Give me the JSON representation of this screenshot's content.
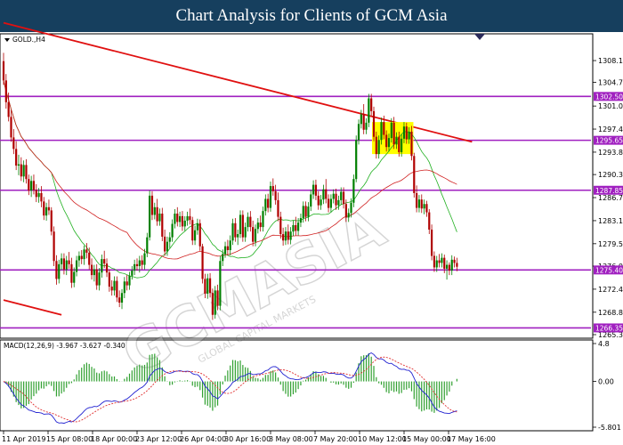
{
  "banner": {
    "title": "Chart Analysis for Clients of GCM Asia"
  },
  "watermark": {
    "text": "GCMASIA",
    "sub": "GLOBAL CAPITAL MARKETS"
  },
  "colors": {
    "bull": "#008000",
    "bear": "#b00000",
    "level": "#a020c0",
    "trend": "#e01010",
    "ma_green": "#20b020",
    "ma_red": "#d02020",
    "macd_line": "#2020d0",
    "signal": "#e03030",
    "hist": "#30a030",
    "highlight": "#ffff00",
    "banner_bg": "#163f5e"
  },
  "chart_data": [
    {
      "type": "candlestick",
      "symbol": "GOLD.,H4",
      "ylim": [
        1265.3,
        1312.0
      ],
      "price_ticks": [
        "1308.10",
        "1304.70",
        "1301.00",
        "1297.40",
        "1293.80",
        "1290.30",
        "1286.70",
        "1283.10",
        "1279.50",
        "1276.00",
        "1272.40",
        "1268.80",
        "1265.30"
      ],
      "x_labels": [
        "11 Apr 2019",
        "15 Apr 08:00",
        "18 Apr 00:00",
        "23 Apr 12:00",
        "26 Apr 04:00",
        "30 Apr 16:00",
        "3 May 08:00",
        "7 May 20:00",
        "10 May 12:00",
        "15 May 00:00",
        "17 May 16:00"
      ],
      "levels": [
        {
          "value": 1302.5,
          "label": "1302.50"
        },
        {
          "value": 1295.65,
          "label": "1295.65"
        },
        {
          "value": 1287.85,
          "label": "1287.85"
        },
        {
          "value": 1275.4,
          "label": "1275.40"
        },
        {
          "value": 1266.35,
          "label": "1266.35"
        }
      ],
      "trendlines": [
        {
          "from": [
            0,
            1314.0
          ],
          "to": [
            186,
            1295.4
          ]
        },
        {
          "from": [
            0,
            1270.7
          ],
          "to": [
            23,
            1268.4
          ]
        }
      ],
      "highlight_zone": {
        "from_bar": 147,
        "to_bar": 162,
        "ylim": [
          1293.5,
          1298.5
        ]
      },
      "candles": [
        [
          1308.0,
          1309.3,
          1304.3,
          1305.0
        ],
        [
          1305.0,
          1306.0,
          1300.6,
          1301.6
        ],
        [
          1301.6,
          1303.1,
          1298.6,
          1299.3
        ],
        [
          1299.3,
          1300.4,
          1295.4,
          1296.1
        ],
        [
          1296.1,
          1297.4,
          1293.5,
          1294.3
        ],
        [
          1294.3,
          1295.5,
          1291.0,
          1291.7
        ],
        [
          1291.7,
          1293.4,
          1290.2,
          1291.9
        ],
        [
          1291.9,
          1293.0,
          1289.3,
          1290.0
        ],
        [
          1290.0,
          1292.5,
          1289.1,
          1291.8
        ],
        [
          1291.8,
          1292.7,
          1288.9,
          1289.6
        ],
        [
          1289.6,
          1290.3,
          1287.1,
          1287.8
        ],
        [
          1287.8,
          1290.1,
          1286.8,
          1289.3
        ],
        [
          1289.3,
          1290.3,
          1287.2,
          1287.9
        ],
        [
          1287.9,
          1288.8,
          1286.0,
          1286.8
        ],
        [
          1286.8,
          1288.2,
          1285.9,
          1287.4
        ],
        [
          1287.4,
          1288.5,
          1285.2,
          1286.1
        ],
        [
          1286.1,
          1286.8,
          1283.2,
          1283.9
        ],
        [
          1283.9,
          1285.9,
          1283.1,
          1285.2
        ],
        [
          1285.2,
          1286.4,
          1284.0,
          1284.7
        ],
        [
          1284.7,
          1285.2,
          1280.8,
          1281.4
        ],
        [
          1281.4,
          1282.2,
          1276.0,
          1276.8
        ],
        [
          1276.8,
          1277.7,
          1273.1,
          1274.0
        ],
        [
          1274.0,
          1277.0,
          1273.3,
          1276.3
        ],
        [
          1276.3,
          1278.0,
          1275.4,
          1277.2
        ],
        [
          1277.2,
          1278.0,
          1274.7,
          1275.5
        ],
        [
          1275.5,
          1277.6,
          1274.6,
          1276.9
        ],
        [
          1276.9,
          1278.2,
          1275.6,
          1276.3
        ],
        [
          1276.3,
          1277.3,
          1272.6,
          1273.4
        ],
        [
          1273.4,
          1275.8,
          1272.7,
          1275.1
        ],
        [
          1275.1,
          1277.6,
          1274.4,
          1276.9
        ],
        [
          1276.9,
          1278.3,
          1275.9,
          1277.6
        ],
        [
          1277.6,
          1278.5,
          1276.3,
          1277.1
        ],
        [
          1277.1,
          1279.2,
          1276.2,
          1278.6
        ],
        [
          1278.6,
          1279.6,
          1277.2,
          1278.1
        ],
        [
          1278.1,
          1278.9,
          1275.5,
          1276.2
        ],
        [
          1276.2,
          1277.2,
          1273.9,
          1274.6
        ],
        [
          1274.6,
          1276.2,
          1273.6,
          1275.5
        ],
        [
          1275.5,
          1276.3,
          1272.3,
          1273.0
        ],
        [
          1273.0,
          1275.7,
          1272.2,
          1275.0
        ],
        [
          1275.0,
          1277.8,
          1274.2,
          1277.1
        ],
        [
          1277.1,
          1278.4,
          1275.7,
          1276.4
        ],
        [
          1276.4,
          1277.2,
          1274.3,
          1275.0
        ],
        [
          1275.0,
          1275.5,
          1272.0,
          1272.8
        ],
        [
          1272.8,
          1273.8,
          1271.4,
          1272.2
        ],
        [
          1272.2,
          1274.4,
          1271.4,
          1273.7
        ],
        [
          1273.7,
          1274.4,
          1270.4,
          1271.1
        ],
        [
          1271.1,
          1272.2,
          1269.6,
          1270.3
        ],
        [
          1270.3,
          1272.4,
          1269.3,
          1271.8
        ],
        [
          1271.8,
          1274.3,
          1271.0,
          1273.6
        ],
        [
          1273.6,
          1274.6,
          1272.2,
          1273.0
        ],
        [
          1273.0,
          1275.1,
          1272.3,
          1274.5
        ],
        [
          1274.5,
          1276.0,
          1273.9,
          1275.3
        ],
        [
          1275.3,
          1277.0,
          1274.6,
          1276.3
        ],
        [
          1276.3,
          1277.2,
          1275.3,
          1276.0
        ],
        [
          1276.0,
          1277.6,
          1275.0,
          1276.9
        ],
        [
          1276.9,
          1277.7,
          1275.5,
          1276.2
        ],
        [
          1276.2,
          1278.7,
          1275.5,
          1278.0
        ],
        [
          1278.0,
          1281.2,
          1277.4,
          1280.5
        ],
        [
          1280.5,
          1287.8,
          1280.0,
          1287.0
        ],
        [
          1287.0,
          1287.7,
          1283.2,
          1284.0
        ],
        [
          1284.0,
          1285.9,
          1283.3,
          1285.2
        ],
        [
          1285.2,
          1286.5,
          1282.3,
          1283.0
        ],
        [
          1283.0,
          1285.0,
          1282.3,
          1284.2
        ],
        [
          1284.2,
          1285.1,
          1279.9,
          1280.6
        ],
        [
          1280.6,
          1281.7,
          1277.6,
          1278.3
        ],
        [
          1278.3,
          1280.6,
          1277.6,
          1279.8
        ],
        [
          1279.8,
          1281.3,
          1278.8,
          1280.5
        ],
        [
          1280.5,
          1283.3,
          1279.8,
          1282.6
        ],
        [
          1282.6,
          1284.9,
          1281.9,
          1284.2
        ],
        [
          1284.2,
          1285.2,
          1282.2,
          1282.9
        ],
        [
          1282.9,
          1284.5,
          1282.1,
          1283.8
        ],
        [
          1283.8,
          1284.6,
          1281.5,
          1282.2
        ],
        [
          1282.2,
          1283.8,
          1281.5,
          1283.1
        ],
        [
          1283.1,
          1284.5,
          1282.3,
          1283.8
        ],
        [
          1283.8,
          1285.0,
          1282.5,
          1283.2
        ],
        [
          1283.2,
          1283.7,
          1279.3,
          1280.0
        ],
        [
          1280.0,
          1282.3,
          1279.3,
          1281.6
        ],
        [
          1281.6,
          1283.4,
          1280.9,
          1282.7
        ],
        [
          1282.7,
          1283.3,
          1278.4,
          1279.1
        ],
        [
          1279.1,
          1279.5,
          1273.3,
          1274.0
        ],
        [
          1274.0,
          1274.8,
          1271.0,
          1271.7
        ],
        [
          1271.7,
          1274.8,
          1270.9,
          1274.1
        ],
        [
          1274.1,
          1274.9,
          1271.1,
          1271.8
        ],
        [
          1271.8,
          1272.5,
          1267.6,
          1268.4
        ],
        [
          1268.4,
          1272.9,
          1267.8,
          1272.2
        ],
        [
          1272.2,
          1273.1,
          1269.1,
          1269.8
        ],
        [
          1269.8,
          1277.6,
          1269.1,
          1276.8
        ],
        [
          1276.8,
          1278.6,
          1276.0,
          1277.9
        ],
        [
          1277.9,
          1279.8,
          1277.3,
          1279.1
        ],
        [
          1279.1,
          1280.1,
          1277.7,
          1278.5
        ],
        [
          1278.5,
          1280.8,
          1277.7,
          1280.0
        ],
        [
          1280.0,
          1283.4,
          1279.3,
          1282.7
        ],
        [
          1282.7,
          1283.5,
          1279.8,
          1280.5
        ],
        [
          1280.5,
          1281.7,
          1279.3,
          1281.0
        ],
        [
          1281.0,
          1284.7,
          1280.4,
          1284.0
        ],
        [
          1284.0,
          1284.7,
          1279.8,
          1280.5
        ],
        [
          1280.5,
          1282.8,
          1279.8,
          1282.1
        ],
        [
          1282.1,
          1284.4,
          1281.4,
          1283.7
        ],
        [
          1283.7,
          1284.6,
          1281.4,
          1282.1
        ],
        [
          1282.1,
          1283.1,
          1279.1,
          1279.8
        ],
        [
          1279.8,
          1282.5,
          1279.1,
          1281.8
        ],
        [
          1281.8,
          1283.5,
          1281.1,
          1282.8
        ],
        [
          1282.8,
          1283.9,
          1281.4,
          1282.1
        ],
        [
          1282.1,
          1285.3,
          1281.4,
          1284.6
        ],
        [
          1284.6,
          1287.2,
          1283.9,
          1286.5
        ],
        [
          1286.5,
          1287.3,
          1284.4,
          1285.1
        ],
        [
          1285.1,
          1289.2,
          1284.5,
          1288.5
        ],
        [
          1288.5,
          1289.7,
          1287.0,
          1287.7
        ],
        [
          1287.7,
          1288.7,
          1285.6,
          1286.3
        ],
        [
          1286.3,
          1287.5,
          1283.0,
          1283.7
        ],
        [
          1283.7,
          1284.5,
          1280.3,
          1281.0
        ],
        [
          1281.0,
          1282.0,
          1279.2,
          1280.0
        ],
        [
          1280.0,
          1282.1,
          1279.3,
          1281.4
        ],
        [
          1281.4,
          1282.5,
          1279.4,
          1280.1
        ],
        [
          1280.1,
          1282.1,
          1279.4,
          1281.4
        ],
        [
          1281.4,
          1283.1,
          1280.7,
          1282.4
        ],
        [
          1282.4,
          1283.7,
          1280.8,
          1281.5
        ],
        [
          1281.5,
          1283.5,
          1280.8,
          1282.8
        ],
        [
          1282.8,
          1284.2,
          1282.1,
          1283.5
        ],
        [
          1283.5,
          1286.1,
          1282.8,
          1285.4
        ],
        [
          1285.4,
          1286.1,
          1283.0,
          1283.7
        ],
        [
          1283.7,
          1286.0,
          1283.0,
          1285.3
        ],
        [
          1285.3,
          1287.9,
          1284.6,
          1287.2
        ],
        [
          1287.2,
          1289.4,
          1286.5,
          1288.7
        ],
        [
          1288.7,
          1289.5,
          1286.3,
          1287.0
        ],
        [
          1287.0,
          1287.7,
          1284.8,
          1285.5
        ],
        [
          1285.5,
          1287.1,
          1284.8,
          1286.4
        ],
        [
          1286.4,
          1288.7,
          1285.7,
          1288.0
        ],
        [
          1288.0,
          1289.6,
          1285.8,
          1286.5
        ],
        [
          1286.5,
          1287.2,
          1284.4,
          1285.1
        ],
        [
          1285.1,
          1287.2,
          1284.4,
          1286.5
        ],
        [
          1286.5,
          1288.0,
          1285.8,
          1287.3
        ],
        [
          1287.3,
          1288.1,
          1284.8,
          1285.5
        ],
        [
          1285.5,
          1287.0,
          1284.8,
          1286.3
        ],
        [
          1286.3,
          1288.3,
          1285.6,
          1287.6
        ],
        [
          1287.6,
          1288.3,
          1285.0,
          1285.7
        ],
        [
          1285.7,
          1286.4,
          1282.9,
          1283.6
        ],
        [
          1283.6,
          1285.0,
          1282.9,
          1284.3
        ],
        [
          1284.3,
          1286.6,
          1283.6,
          1285.9
        ],
        [
          1285.9,
          1290.3,
          1285.2,
          1289.6
        ],
        [
          1289.6,
          1296.4,
          1289.1,
          1295.7
        ],
        [
          1295.7,
          1298.9,
          1295.0,
          1298.2
        ],
        [
          1298.2,
          1300.4,
          1297.5,
          1299.7
        ],
        [
          1299.7,
          1301.3,
          1296.6,
          1297.3
        ],
        [
          1297.3,
          1299.1,
          1296.6,
          1298.4
        ],
        [
          1298.4,
          1302.9,
          1297.7,
          1302.2
        ],
        [
          1302.2,
          1302.9,
          1299.5,
          1300.2
        ],
        [
          1300.2,
          1300.9,
          1295.5,
          1296.2
        ],
        [
          1296.2,
          1297.0,
          1292.8,
          1293.5
        ],
        [
          1293.5,
          1296.4,
          1292.8,
          1295.7
        ],
        [
          1295.7,
          1299.2,
          1295.0,
          1298.5
        ],
        [
          1298.5,
          1299.5,
          1295.8,
          1296.5
        ],
        [
          1296.5,
          1297.2,
          1293.9,
          1294.6
        ],
        [
          1294.6,
          1296.7,
          1293.9,
          1296.0
        ],
        [
          1296.0,
          1299.1,
          1295.3,
          1298.4
        ],
        [
          1298.4,
          1299.3,
          1294.3,
          1295.0
        ],
        [
          1295.0,
          1296.9,
          1294.3,
          1296.2
        ],
        [
          1296.2,
          1297.0,
          1293.1,
          1293.8
        ],
        [
          1293.8,
          1296.6,
          1293.1,
          1295.9
        ],
        [
          1295.9,
          1298.5,
          1295.2,
          1297.8
        ],
        [
          1297.8,
          1298.4,
          1295.1,
          1295.8
        ],
        [
          1295.8,
          1297.7,
          1295.1,
          1297.0
        ],
        [
          1297.0,
          1297.9,
          1292.5,
          1293.2
        ],
        [
          1293.2,
          1293.7,
          1286.7,
          1287.4
        ],
        [
          1287.4,
          1288.6,
          1284.4,
          1285.1
        ],
        [
          1285.1,
          1287.1,
          1284.4,
          1286.4
        ],
        [
          1286.4,
          1287.2,
          1284.3,
          1285.0
        ],
        [
          1285.0,
          1286.4,
          1284.1,
          1285.7
        ],
        [
          1285.7,
          1286.2,
          1283.7,
          1284.4
        ],
        [
          1284.4,
          1284.9,
          1281.0,
          1281.7
        ],
        [
          1281.7,
          1282.5,
          1276.9,
          1277.6
        ],
        [
          1277.6,
          1278.3,
          1275.1,
          1275.8
        ],
        [
          1275.8,
          1277.6,
          1275.1,
          1276.9
        ],
        [
          1276.9,
          1277.9,
          1275.8,
          1276.5
        ],
        [
          1276.5,
          1278.0,
          1275.8,
          1277.3
        ],
        [
          1277.3,
          1277.8,
          1274.9,
          1275.6
        ],
        [
          1275.6,
          1276.9,
          1273.9,
          1276.2
        ],
        [
          1276.2,
          1276.6,
          1274.6,
          1275.3
        ],
        [
          1275.3,
          1277.7,
          1274.6,
          1277.0
        ],
        [
          1277.0,
          1277.5,
          1275.8,
          1276.5
        ],
        [
          1276.5,
          1277.3,
          1275.2,
          1275.9
        ]
      ]
    },
    {
      "type": "line",
      "indicator": "MACD(12,26,9) -3.967 -3.627 -0.340",
      "ylim": [
        -5.801,
        4.8
      ],
      "y_ticks": [
        "4.8",
        "0.00",
        "-5.801"
      ],
      "hist_style": "bar"
    }
  ]
}
